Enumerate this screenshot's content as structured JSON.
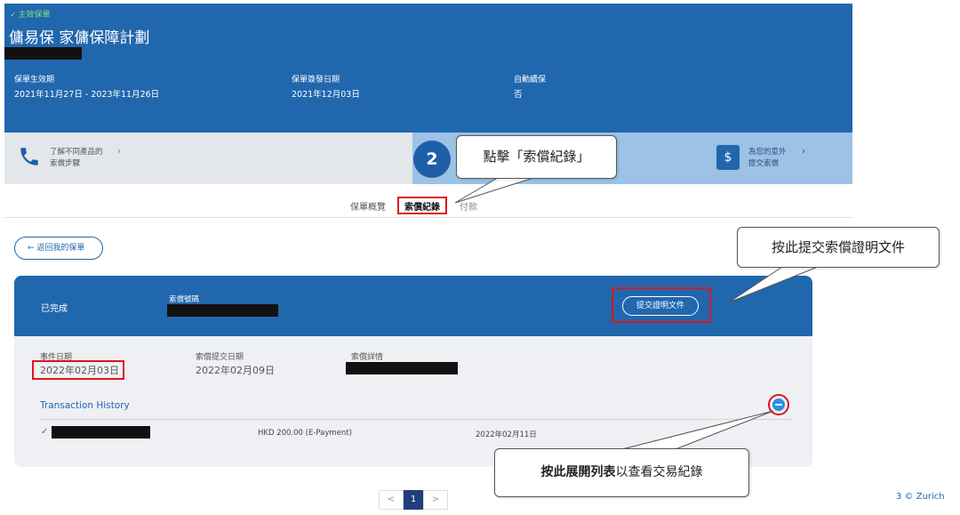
{
  "header": {
    "status": "主效保單",
    "status_icon": "check-icon",
    "plan_title": "傭易保 家傭保障計劃",
    "fields": [
      {
        "label": "保單生效期",
        "value": "2021年11月27日 - 2023年11月26日"
      },
      {
        "label": "保單簽發日期",
        "value": "2021年12月03日"
      },
      {
        "label": "自動續保",
        "value": "否"
      }
    ],
    "bg_color": "#2167ae"
  },
  "info_bar": {
    "left_text_1": "了解不同產品的",
    "left_text_2": "索償步驟",
    "left_icon": "phone-icon",
    "right_text_1": "為您的意外",
    "right_text_2": "提交索償",
    "right_icon": "document-dollar-icon"
  },
  "annotations": {
    "step_number": "2",
    "step_callout": "點擊「索償紀錄」",
    "submit_callout": "按此提交索償證明文件",
    "expand_callout_bold": "按此展開列表",
    "expand_callout_rest": "以查看交易紀錄",
    "highlight_color": "#e0141e"
  },
  "tabs": {
    "overview": "保單概覽",
    "claims": "索償紀錄",
    "payment": "付款"
  },
  "back_button": "返回我的保單",
  "claim_card": {
    "status": "已完成",
    "claim_no_label": "索償號碼",
    "submit_docs_button": "提交證明文件",
    "event_date_label": "事件日期",
    "event_date": "2022年02月03日",
    "submit_date_label": "索償提交日期",
    "submit_date": "2022年02月09日",
    "details_label": "索償詳情",
    "transaction_title": "Transaction History",
    "transactions": [
      {
        "amount": "HKD 200.00 (E-Payment)",
        "date": "2022年02月11日"
      }
    ],
    "expand_icon": "minus-circle-icon"
  },
  "pagination": {
    "prev": "<",
    "current": "1",
    "next": ">"
  },
  "footer": "3  © Zurich"
}
